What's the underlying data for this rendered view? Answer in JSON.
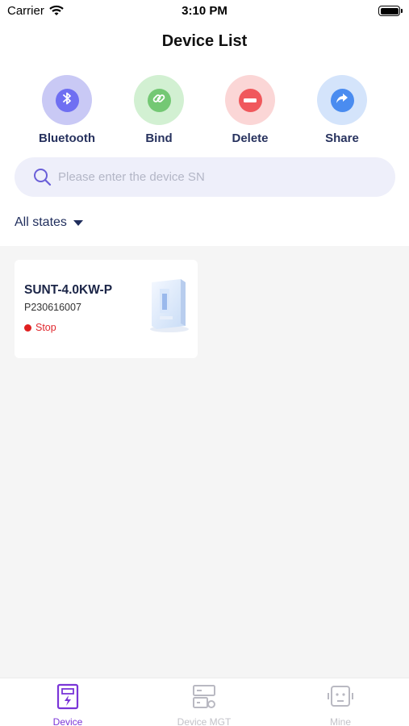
{
  "status_bar": {
    "carrier": "Carrier",
    "time": "3:10 PM"
  },
  "header": {
    "title": "Device List"
  },
  "actions": [
    {
      "label": "Bluetooth",
      "icon": "bluetooth-icon"
    },
    {
      "label": "Bind",
      "icon": "link-icon"
    },
    {
      "label": "Delete",
      "icon": "minus-icon"
    },
    {
      "label": "Share",
      "icon": "share-arrow-icon"
    }
  ],
  "search": {
    "placeholder": "Please enter the device SN",
    "value": ""
  },
  "filter": {
    "label": "All states"
  },
  "devices": [
    {
      "name": "SUNT-4.0KW-P",
      "sn": "P230616007",
      "status": "Stop",
      "status_color": "#e02020"
    }
  ],
  "tabs": [
    {
      "label": "Device",
      "active": true
    },
    {
      "label": "Device MGT",
      "active": false
    },
    {
      "label": "Mine",
      "active": false
    }
  ],
  "colors": {
    "accent": "#7a35d8",
    "inactive": "#c2c2c8",
    "stop": "#e02020"
  }
}
